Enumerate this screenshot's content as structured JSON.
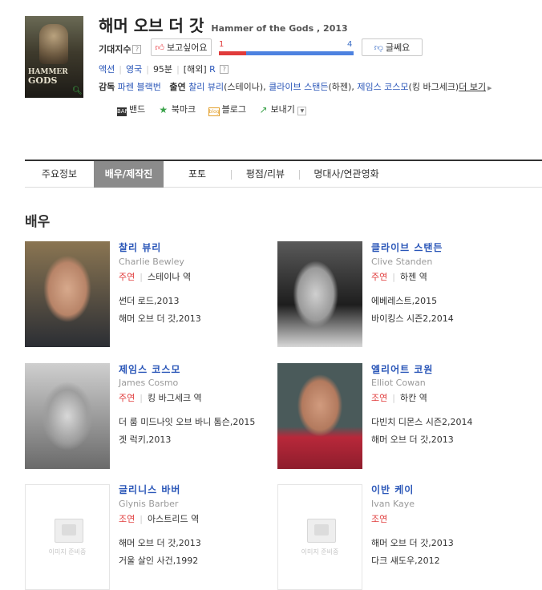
{
  "movie": {
    "title_ko": "해머 오브 더 갓",
    "title_en": "Hammer of the Gods , 2013",
    "poster_text_1": "HAMMER",
    "poster_text_2": "GODS"
  },
  "rating": {
    "label": "기대지수",
    "help": "?",
    "want_label": "보고싶어요",
    "meh_label": "글쎄요",
    "want_count": "1",
    "meh_count": "4",
    "want_fraction": 0.2
  },
  "meta": {
    "genre": "액션",
    "country": "영국",
    "runtime": "95분",
    "release_prefix": "[해외]",
    "grade": "R",
    "grade_help": "?"
  },
  "crew": {
    "director_label": "감독",
    "director": "파렌 블랙번",
    "cast_label": "출연",
    "cast1": "찰리 뷰리",
    "cast1_role": "(스테이나),",
    "cast2": "클라이브 스탠든",
    "cast2_role": "(하젠),",
    "cast3": "제임스 코스모",
    "cast3_role": "(킹 바그세크)",
    "more": "더 보기"
  },
  "share": {
    "band": "밴드",
    "bookmark": "북마크",
    "blog": "블로그",
    "send": "보내기",
    "band_icon_text": "BAND",
    "blog_icon_text": "blog"
  },
  "tabs": [
    "주요정보",
    "배우/제작진",
    "포토",
    "평점/리뷰",
    "명대사/연관영화"
  ],
  "section_title": "배우",
  "placeholder_text": "이미지 준비중",
  "actors": [
    {
      "name_ko": "찰리 뷰리",
      "name_en": "Charlie Bewley",
      "role_type": "주연",
      "role": "스테이나 역",
      "works": [
        "썬더 로드,2013",
        "해머 오브 더 갓,2013"
      ]
    },
    {
      "name_ko": "클라이브 스탠든",
      "name_en": "Clive Standen",
      "role_type": "주연",
      "role": "하젠 역",
      "works": [
        "에베레스트,2015",
        "바이킹스 시즌2,2014"
      ]
    },
    {
      "name_ko": "제임스 코스모",
      "name_en": "James Cosmo",
      "role_type": "주연",
      "role": "킹 바그세크 역",
      "works": [
        "더 룸 미드나잇 오브 바니 톰슨,2015",
        "겟 럭키,2013"
      ]
    },
    {
      "name_ko": "엘리어트 코원",
      "name_en": "Elliot Cowan",
      "role_type": "조연",
      "role": "하칸 역",
      "works": [
        "다빈치 디몬스 시즌2,2014",
        "해머 오브 더 갓,2013"
      ]
    },
    {
      "name_ko": "글리니스 바버",
      "name_en": "Glynis Barber",
      "role_type": "조연",
      "role": "아스트리드 역",
      "works": [
        "해머 오브 더 갓,2013",
        "거울 살인 사건,1992"
      ]
    },
    {
      "name_ko": "이반 케이",
      "name_en": "Ivan Kaye",
      "role_type": "조연",
      "role": "",
      "works": [
        "해머 오브 더 갓,2013",
        "다크 섀도우,2012"
      ]
    }
  ]
}
